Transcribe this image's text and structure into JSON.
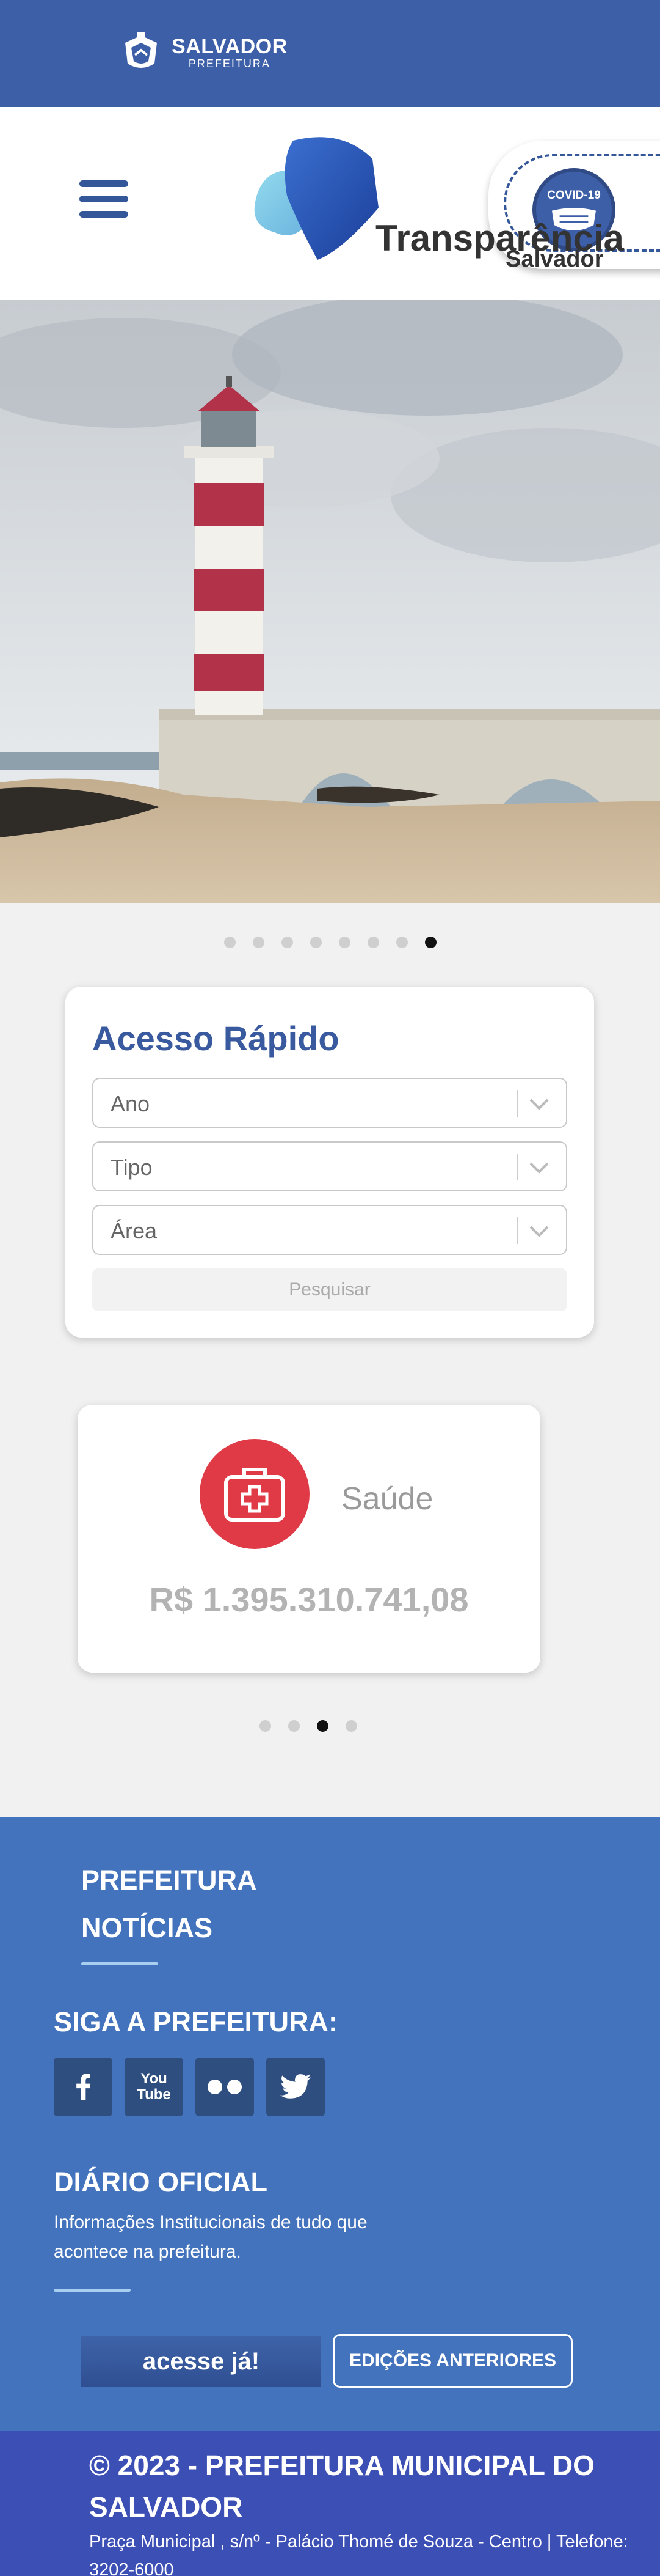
{
  "topbar": {
    "logo_title": "SALVADOR",
    "logo_subtitle": "PREFEITURA"
  },
  "header": {
    "brand": "Transparência",
    "brand_sub": "Salvador",
    "covid_label": "COVID-19",
    "menu_icon": "hamburger-icon"
  },
  "hero": {
    "slides": 8,
    "active_slide": 8
  },
  "quick_access": {
    "title": "Acesso Rápido",
    "selects": [
      "Ano",
      "Tipo",
      "Área"
    ],
    "search_label": "Pesquisar"
  },
  "spending_card": {
    "label": "Saúde",
    "value": "R$ 1.395.310.741,08",
    "icon": "first-aid-kit-icon",
    "icon_color": "#e03a46",
    "slides": 4,
    "active_slide": 3
  },
  "footer": {
    "links": [
      "PREFEITURA",
      "NOTÍCIAS"
    ],
    "social_heading": "SIGA A PREFEITURA:",
    "social": [
      "facebook-icon",
      "youtube-icon",
      "flickr-icon",
      "twitter-icon"
    ],
    "youtube_text": [
      "You",
      "Tube"
    ],
    "diario_heading": "DIÁRIO OFICIAL",
    "diario_desc": "Informações Institucionais de tudo que acontece na prefeitura.",
    "acesse_label": "acesse já!",
    "edicoes_label": "EDIÇÕES ANTERIORES"
  },
  "bottom": {
    "copyright": "© 2023 - PREFEITURA MUNICIPAL DO SALVADOR",
    "address": "Praça Municipal , s/nº - Palácio Thomé de Souza - Centro | Telefone: 3202-6000"
  },
  "colors": {
    "primary": "#3d5fa8",
    "footer": "#4473bd",
    "bottom": "#3c4fb5"
  }
}
